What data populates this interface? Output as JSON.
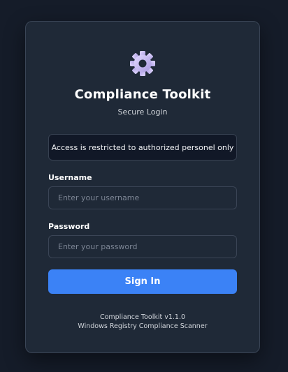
{
  "app": {
    "title": "Compliance Toolkit",
    "subtitle": "Secure Login",
    "logo_icon": "gear-icon"
  },
  "notice": {
    "text": "Access is restricted to authorized personel only"
  },
  "form": {
    "username_label": "Username",
    "username_placeholder": "Enter your username",
    "username_value": "",
    "password_label": "Password",
    "password_placeholder": "Enter your password",
    "password_value": "",
    "submit_label": "Sign In"
  },
  "footer": {
    "version_line": "Compliance Toolkit v1.1.0",
    "description_line": "Windows Registry Compliance Scanner"
  },
  "colors": {
    "background": "#151c29",
    "card": "#1f2937",
    "accent": "#3b82f6",
    "logo": "#c4b5fd"
  }
}
